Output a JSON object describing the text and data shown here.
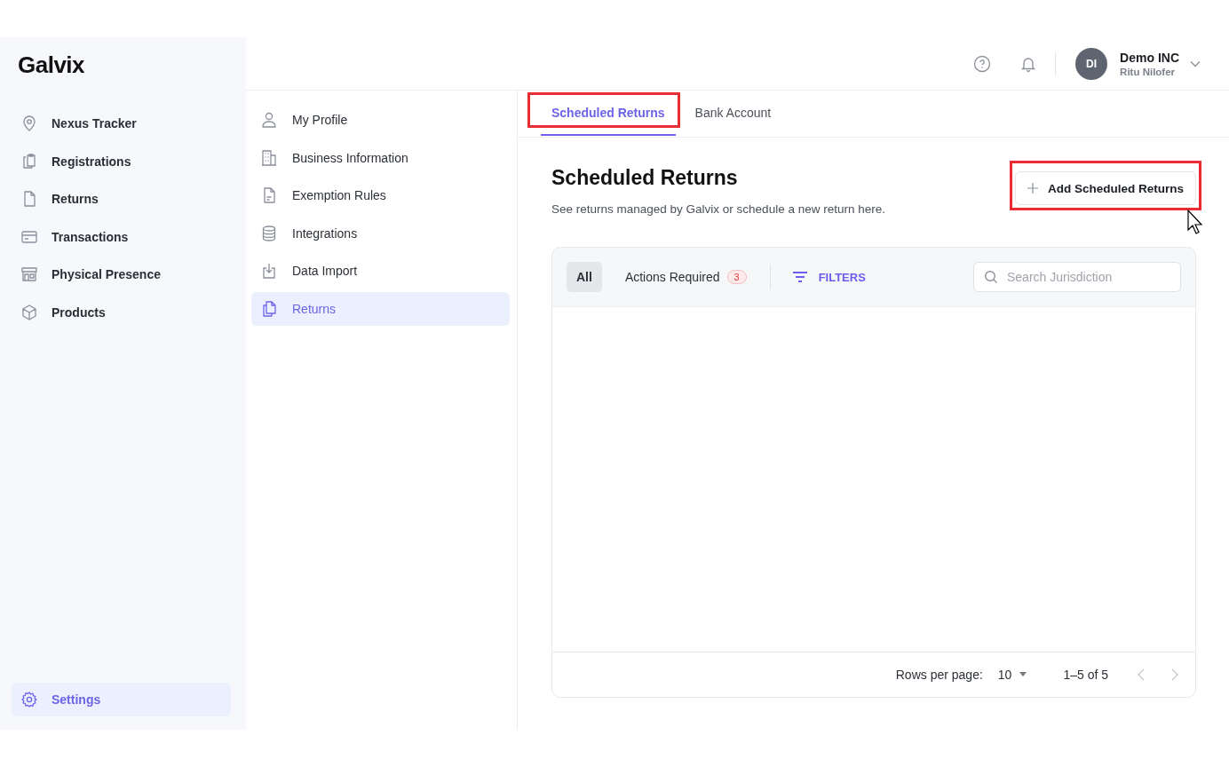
{
  "logo": "Galvix",
  "sidebar": {
    "items": [
      {
        "label": "Nexus Tracker",
        "selected": false
      },
      {
        "label": "Registrations",
        "selected": false
      },
      {
        "label": "Returns",
        "selected": false
      },
      {
        "label": "Transactions",
        "selected": false
      },
      {
        "label": "Physical Presence",
        "selected": false
      },
      {
        "label": "Products",
        "selected": false
      }
    ],
    "footer_item": {
      "label": "Settings",
      "selected": true
    }
  },
  "header": {
    "avatar": "DI",
    "company": "Demo INC",
    "user": "Ritu Nilofer"
  },
  "settings_nav": [
    {
      "label": "My Profile",
      "selected": false
    },
    {
      "label": "Business Information",
      "selected": false
    },
    {
      "label": "Exemption Rules",
      "selected": false
    },
    {
      "label": "Integrations",
      "selected": false
    },
    {
      "label": "Data Import",
      "selected": false
    },
    {
      "label": "Returns",
      "selected": true
    }
  ],
  "tabs": [
    {
      "label": "Scheduled Returns",
      "selected": true,
      "highlighted": true
    },
    {
      "label": "Bank Account",
      "selected": false,
      "highlighted": false
    }
  ],
  "page": {
    "title": "Scheduled Returns",
    "subtitle": "See returns managed by Galvix or schedule a new return here.",
    "add_button": {
      "label": "Add Scheduled Returns",
      "highlighted": true
    }
  },
  "table": {
    "filters": [
      {
        "label": "All",
        "selected": true
      },
      {
        "label": "Actions Required",
        "selected": false,
        "badge": "3"
      }
    ],
    "filters_button": "FILTERS",
    "search": {
      "placeholder": "Search Jurisdiction"
    },
    "footer": {
      "rows_label": "Rows per page:",
      "rows_value": "10",
      "range": "1–5 of 5"
    }
  }
}
